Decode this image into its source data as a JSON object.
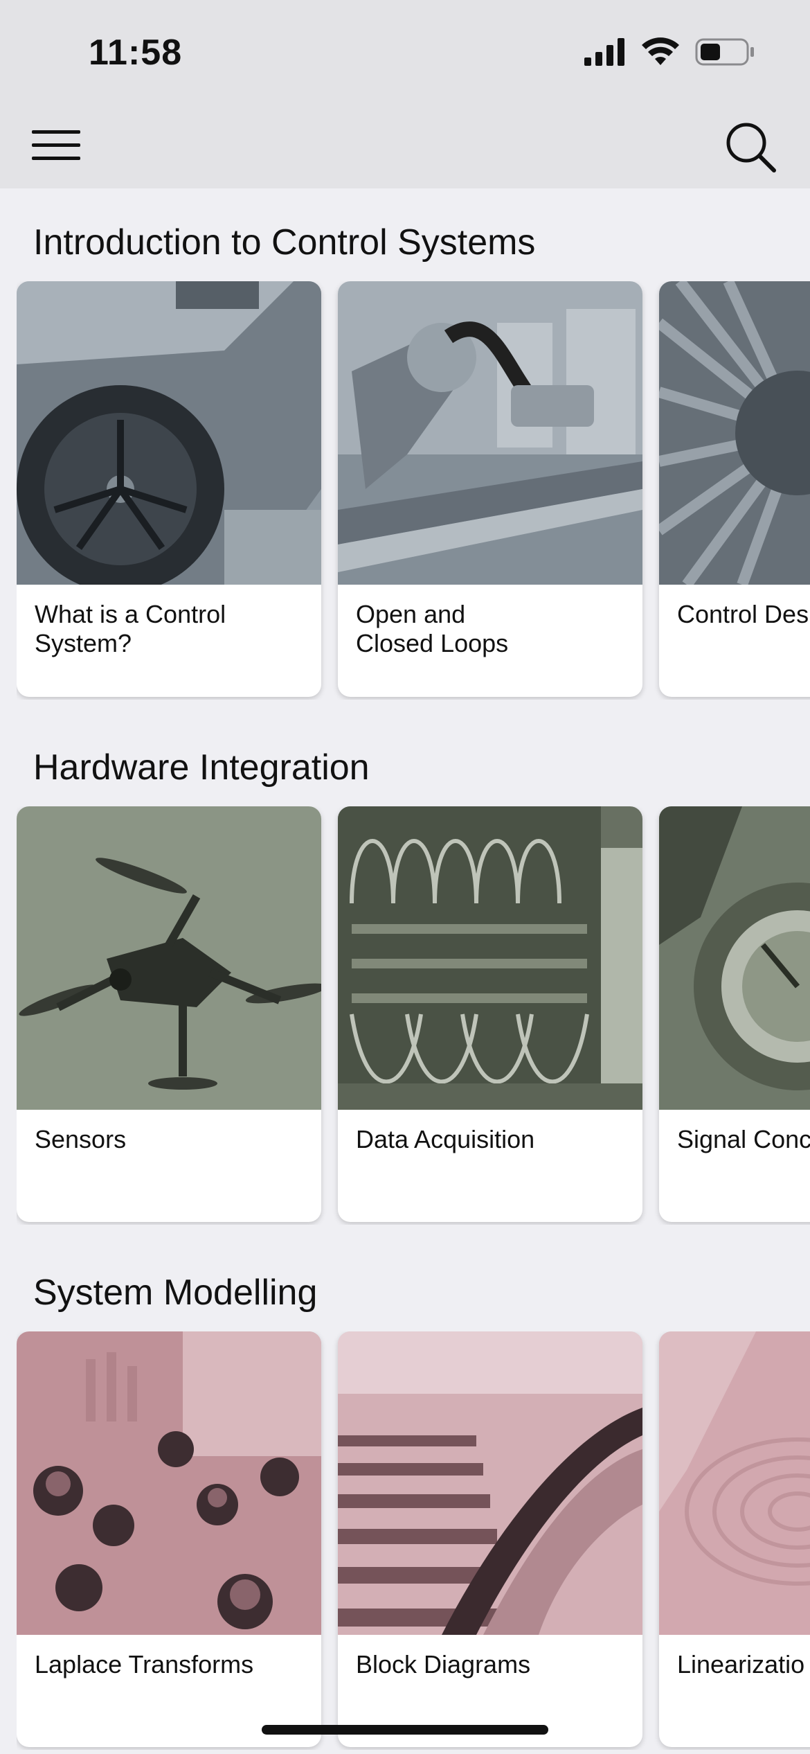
{
  "status": {
    "time": "11:58"
  },
  "icons": {
    "menu": "hamburger-menu-icon",
    "search": "search-icon",
    "signal": "cellular-signal-icon",
    "wifi": "wifi-icon",
    "battery": "battery-icon"
  },
  "sections": [
    {
      "title": "Introduction to Control Systems",
      "tint": "#a9b3bb",
      "cards": [
        {
          "label": "What is a Control\nSystem?"
        },
        {
          "label": "Open and\nClosed Loops"
        },
        {
          "label": "Control Des"
        }
      ]
    },
    {
      "title": "Hardware Integration",
      "tint": "#9ea797",
      "cards": [
        {
          "label": "Sensors"
        },
        {
          "label": "Data Acquisition"
        },
        {
          "label": "Signal Conc"
        }
      ]
    },
    {
      "title": "System Modelling",
      "tint": "#d5b0b6",
      "cards": [
        {
          "label": "Laplace Transforms"
        },
        {
          "label": "Block Diagrams"
        },
        {
          "label": "Linearizatio"
        }
      ]
    }
  ]
}
